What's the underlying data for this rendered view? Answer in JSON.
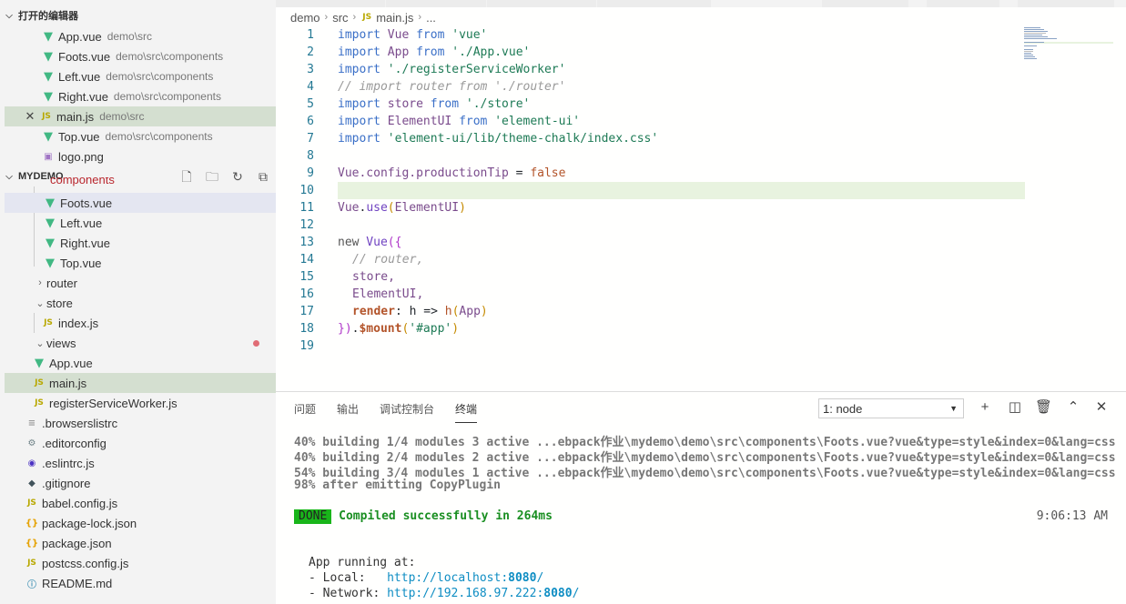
{
  "open_editors": {
    "title": "打开的编辑器",
    "items": [
      {
        "icon": "vue-icon",
        "label": "App.vue",
        "desc": "demo\\src"
      },
      {
        "icon": "vue-icon",
        "label": "Foots.vue",
        "desc": "demo\\src\\components"
      },
      {
        "icon": "vue-icon",
        "label": "Left.vue",
        "desc": "demo\\src\\components"
      },
      {
        "icon": "vue-icon",
        "label": "Right.vue",
        "desc": "demo\\src\\components"
      },
      {
        "icon": "js-icon",
        "label": "main.js",
        "desc": "demo\\src",
        "active": true
      },
      {
        "icon": "vue-icon",
        "label": "Top.vue",
        "desc": "demo\\src\\components"
      },
      {
        "icon": "image-icon",
        "label": "logo.png",
        "desc": ""
      }
    ]
  },
  "explorer": {
    "title": "MYDEMO",
    "partial_label": "components",
    "items": [
      {
        "icon": "vue-icon",
        "label": "Foots.vue"
      },
      {
        "icon": "vue-icon",
        "label": "Left.vue"
      },
      {
        "icon": "vue-icon",
        "label": "Right.vue"
      },
      {
        "icon": "vue-icon",
        "label": "Top.vue"
      },
      {
        "icon": "chevron-right-icon",
        "label": "router"
      },
      {
        "icon": "chevron-down-icon",
        "label": "store"
      },
      {
        "icon": "js-icon",
        "label": "index.js"
      },
      {
        "icon": "chevron-down-icon",
        "label": "views"
      },
      {
        "icon": "vue-icon",
        "label": "App.vue"
      },
      {
        "icon": "js-icon",
        "label": "main.js"
      },
      {
        "icon": "js-icon",
        "label": "registerServiceWorker.js"
      },
      {
        "icon": "browserslist-icon",
        "label": ".browserslistrc"
      },
      {
        "icon": "gear-icon",
        "label": ".editorconfig"
      },
      {
        "icon": "eslint-icon",
        "label": ".eslintrc.js"
      },
      {
        "icon": "git-icon",
        "label": ".gitignore"
      },
      {
        "icon": "js-icon",
        "label": "babel.config.js"
      },
      {
        "icon": "braces-icon",
        "label": "package-lock.json"
      },
      {
        "icon": "braces-icon",
        "label": "package.json"
      },
      {
        "icon": "js-icon",
        "label": "postcss.config.js"
      },
      {
        "icon": "info-icon",
        "label": "README.md"
      }
    ]
  },
  "breadcrumb": {
    "p1": "demo",
    "p2": "src",
    "p3": "main.js",
    "p4": "..."
  },
  "code": {
    "line_numbers": [
      "1",
      "2",
      "3",
      "4",
      "5",
      "6",
      "7",
      "8",
      "9",
      "10",
      "11",
      "12",
      "13",
      "14",
      "15",
      "16",
      "17",
      "18",
      "19"
    ],
    "l1": {
      "a": "import",
      "b": " Vue ",
      "c": "from",
      "d": " 'vue'"
    },
    "l2": {
      "a": "import",
      "b": " App ",
      "c": "from",
      "d": " './App.vue'"
    },
    "l3": {
      "a": "import",
      "d": " './registerServiceWorker'"
    },
    "l4": "// import router from './router'",
    "l5": {
      "a": "import",
      "b": " store ",
      "c": "from",
      "d": " './store'"
    },
    "l6": {
      "a": "import",
      "b": " ElementUI ",
      "c": "from",
      "d": " 'element-ui'"
    },
    "l7": {
      "a": "import",
      "d": " 'element-ui/lib/theme-chalk/index.css'"
    },
    "l9": {
      "a": "Vue.config.productionTip",
      "b": " = ",
      "c": "false"
    },
    "l11": {
      "a": "Vue",
      "b": ".",
      "c": "use",
      "d": "(",
      "e": "ElementUI",
      "f": ")"
    },
    "l13": {
      "a": "new",
      "b": " Vue",
      "c": "({"
    },
    "l14": "// router,",
    "l15": "store,",
    "l16": "ElementUI,",
    "l17": {
      "a": "render",
      "b": ": h => ",
      "c": "h",
      "d": "(",
      "e": "App",
      "f": ")"
    },
    "l18": {
      "a": "})",
      "b": ".",
      "c": "$mount",
      "d": "(",
      "e": "'#app'",
      "f": ")"
    }
  },
  "panel": {
    "tabs": [
      "问题",
      "输出",
      "调试控制台",
      "终端"
    ],
    "active_tab": "终端",
    "terminal_select": "1: node"
  },
  "terminal": {
    "lines": [
      "40% building 1/4 modules 3 active ...ebpack作业\\mydemo\\demo\\src\\components\\Foots.vue?vue&type=style&index=0&lang=css",
      "40% building 2/4 modules 2 active ...ebpack作业\\mydemo\\demo\\src\\components\\Foots.vue?vue&type=style&index=0&lang=css",
      "54% building 3/4 modules 1 active ...ebpack作业\\mydemo\\demo\\src\\components\\Foots.vue?vue&type=style&index=0&lang=css",
      "98% after emitting CopyPlugin"
    ],
    "done_badge": "DONE",
    "compiled_msg": "Compiled successfully in 264ms",
    "time": "9:06:13 AM",
    "running": "App running at:",
    "local_label": "- Local:   ",
    "local_url": "http://localhost:",
    "local_port": "8080",
    "local_tail": "/",
    "network_label": "- Network: ",
    "network_url": "http://192.168.97.222:",
    "network_port": "8080",
    "network_tail": "/"
  },
  "colors": {
    "selection": "#d4dfd0",
    "current_line": "#e8f3df",
    "done_badge": "#19b51a",
    "vue": "#41b883"
  }
}
